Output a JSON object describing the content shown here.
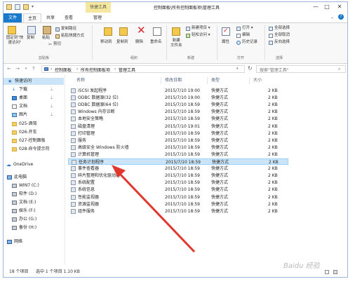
{
  "titlebar": {
    "context_tab": "快捷工具",
    "title": "控制面板\\所有控制面板项\\管理工具",
    "minimize": "—",
    "maximize": "□",
    "close": "✕"
  },
  "tabs": {
    "file": "文件",
    "home": "主页",
    "share": "共享",
    "view": "查看",
    "manage": "管理"
  },
  "ribbon": {
    "pin_quick_access": "固定到\"快\n速访问\"",
    "copy": "复制",
    "paste": "粘贴",
    "copy_path": "复制路径",
    "paste_shortcut": "粘贴快捷方式",
    "cut": "剪切",
    "clipboard_label": "剪贴板",
    "move_to": "移动到",
    "copy_to": "复制到",
    "delete": "删除",
    "rename": "重命名",
    "organize_label": "组织",
    "new_item": "新建项目 ▾",
    "easy_access": "轻松访问 ▾",
    "new_folder": "新建\n文件夹",
    "new_label": "新建",
    "properties": "属性",
    "open": "打开 ▾",
    "edit": "编辑",
    "history": "历史记录",
    "open_label": "打开",
    "select_all": "全部选择",
    "select_none": "全部取消",
    "invert_selection": "反向选择",
    "select_label": "选择"
  },
  "address": {
    "back": "←",
    "forward": "→",
    "up": "↑",
    "crumbs": [
      "控制面板",
      "所有控制面板项",
      "管理工具"
    ],
    "search_placeholder": "搜索\"管理工具\""
  },
  "nav": [
    {
      "label": "快速访问",
      "icon": "star-icon",
      "pinned": false,
      "selected": true
    },
    {
      "label": "下载",
      "icon": "download-icon",
      "pinned": true
    },
    {
      "label": "桌面",
      "icon": "desktop-icon",
      "pinned": true
    },
    {
      "label": "文档",
      "icon": "document-icon",
      "pinned": true
    },
    {
      "label": "图片",
      "icon": "picture-icon",
      "pinned": true
    },
    {
      "label": "025-酒驾",
      "icon": "folder-icon"
    },
    {
      "label": "026-开车",
      "icon": "folder-icon"
    },
    {
      "label": "027-控制面板",
      "icon": "folder-icon"
    },
    {
      "label": "028-命令提示符",
      "icon": "folder-icon"
    },
    {
      "label": "OneDrive",
      "icon": "cloud-icon"
    },
    {
      "label": "此电脑",
      "icon": "computer-icon"
    },
    {
      "label": "WIN7 (C:)",
      "icon": "drive-icon"
    },
    {
      "label": "软件 (D:)",
      "icon": "drive-icon"
    },
    {
      "label": "文档 (E:)",
      "icon": "drive-icon"
    },
    {
      "label": "娱乐 (F:)",
      "icon": "drive-icon"
    },
    {
      "label": "办公 (G:)",
      "icon": "drive-icon"
    },
    {
      "label": "备份 (H:)",
      "icon": "drive-icon"
    },
    {
      "label": "网络",
      "icon": "network-icon"
    }
  ],
  "columns": {
    "name": "名称",
    "date": "修改日期",
    "type": "类型",
    "size": "大小"
  },
  "files": [
    {
      "name": "iSCSI 发起程序",
      "date": "2015/7/10 19:00",
      "type": "快捷方式",
      "size": "2 KB"
    },
    {
      "name": "ODBC 数据源(32 位)",
      "date": "2015/7/10 19:00",
      "type": "快捷方式",
      "size": "2 KB"
    },
    {
      "name": "ODBC 数据源(64 位)",
      "date": "2015/7/10 18:59",
      "type": "快捷方式",
      "size": "2 KB"
    },
    {
      "name": "Windows 内存诊断",
      "date": "2015/7/10 18:59",
      "type": "快捷方式",
      "size": "2 KB"
    },
    {
      "name": "本地安全策略",
      "date": "2015/7/10 18:59",
      "type": "快捷方式",
      "size": "2 KB"
    },
    {
      "name": "磁盘清理",
      "date": "2015/7/10 19:01",
      "type": "快捷方式",
      "size": "2 KB"
    },
    {
      "name": "打印管理",
      "date": "2015/7/10 18:59",
      "type": "快捷方式",
      "size": "2 KB"
    },
    {
      "name": "服务",
      "date": "2015/7/10 18:59",
      "type": "快捷方式",
      "size": "2 KB"
    },
    {
      "name": "高级安全 Windows 防火墙",
      "date": "2015/7/10 18:59",
      "type": "快捷方式",
      "size": "2 KB"
    },
    {
      "name": "计算机管理",
      "date": "2015/7/10 18:59",
      "type": "快捷方式",
      "size": "2 KB"
    },
    {
      "name": "任务计划程序",
      "date": "2015/7/10 18:59",
      "type": "快捷方式",
      "size": "2 KB",
      "selected": true
    },
    {
      "name": "事件查看器",
      "date": "2015/7/10 18:59",
      "type": "快捷方式",
      "size": "2 KB"
    },
    {
      "name": "碎片整理和优化驱动器",
      "date": "2015/7/10 18:59",
      "type": "快捷方式",
      "size": "2 KB"
    },
    {
      "name": "系统配置",
      "date": "2015/7/10 18:59",
      "type": "快捷方式",
      "size": "2 KB"
    },
    {
      "name": "系统信息",
      "date": "2015/7/10 18:59",
      "type": "快捷方式",
      "size": "2 KB"
    },
    {
      "name": "性能监视器",
      "date": "2015/7/10 18:59",
      "type": "快捷方式",
      "size": "2 KB"
    },
    {
      "name": "资源监视器",
      "date": "2015/7/10 18:59",
      "type": "快捷方式",
      "size": "2 KB"
    },
    {
      "name": "组件服务",
      "date": "2015/7/10 18:59",
      "type": "快捷方式",
      "size": "2 KB"
    }
  ],
  "status": {
    "count": "18 个项目",
    "selection": "选中 1 个项目  1.10 KB"
  },
  "watermark": "Baidu 经验",
  "colors": {
    "file_tab": "#1979ca",
    "context_tab": "#f5e79d",
    "selection": "#cce4f7",
    "arrow": "#e0382f"
  }
}
